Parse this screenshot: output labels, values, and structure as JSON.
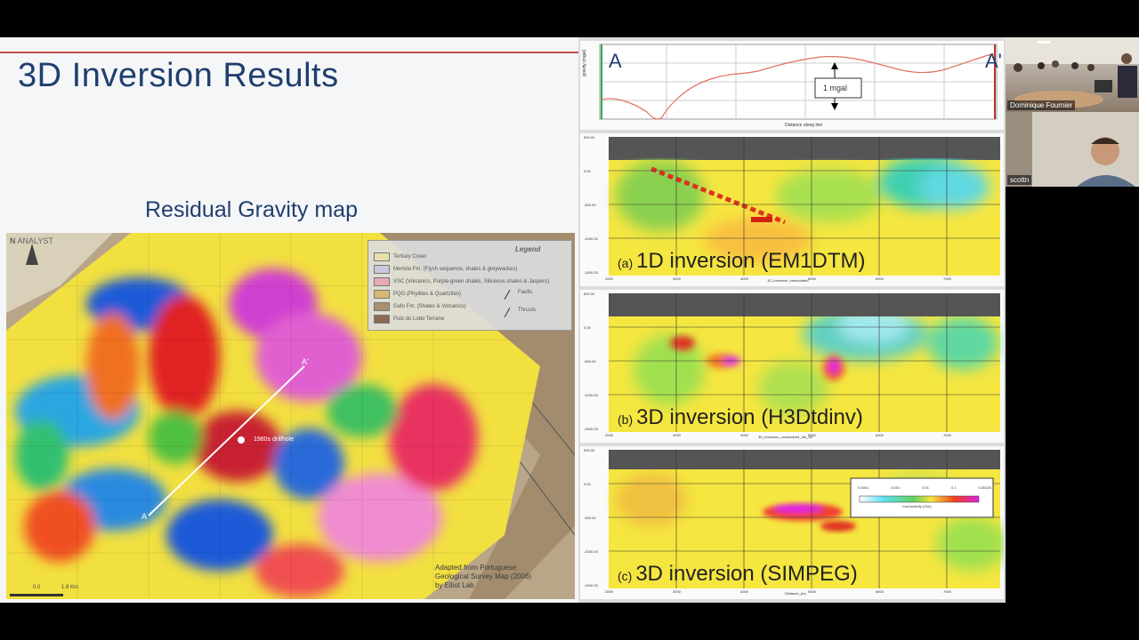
{
  "slide": {
    "title": "3D Inversion Results",
    "map_title": "Residual Gravity map",
    "map": {
      "company_logo": "ANALYST",
      "north_label": "N",
      "profile_start": "A",
      "profile_end": "A'",
      "drillhole_label": "1980s drillhole",
      "scale_labels": [
        "0.0",
        "1.8 Km"
      ],
      "credit_lines": [
        "Adapted from Portuguese",
        "Geological Survey Map (2006)",
        "by Elliot Lab"
      ]
    },
    "legend": {
      "title": "Legend",
      "items": [
        {
          "label": "Tertiary Cover",
          "color": "#e8e0a8"
        },
        {
          "label": "Mertola Fm. (Flysh sequence, shales & greywackes)",
          "color": "#c9c8e0"
        },
        {
          "label": "VSC (Volcanics, Purple-green shales, Siliceous shales & Jaspers)",
          "color": "#e8a8b8"
        },
        {
          "label": "PQG (Phyllites & Quartzites)",
          "color": "#d8b870"
        },
        {
          "label": "Gafo Fm. (Shales & Volcanics)",
          "color": "#a89070"
        },
        {
          "label": "Pulo do Lobo Terrane",
          "color": "#8a6a50"
        }
      ],
      "symbols": [
        "Faults",
        "Thrusts"
      ]
    }
  },
  "profile": {
    "start_label": "A",
    "end_label": "A'",
    "scale_label": "1 mgal",
    "x_axis_label": "Distance along line",
    "y_axis_label": "gravity (mgal)"
  },
  "sections": [
    {
      "prefix": "(a)",
      "label": "1D inversion (EM1DTM)",
      "x_label": "1D_inversion_interpolated"
    },
    {
      "prefix": "(b)",
      "label": "3D inversion (H3Dtdinv)",
      "x_label": "3D_inversion_constrained_3to_3D"
    },
    {
      "prefix": "(c)",
      "label": "3D inversion (SIMPEG)",
      "x_label": "Distance_(m)"
    }
  ],
  "section_x_ticks": [
    "2000",
    "3000",
    "4000",
    "5000",
    "6000",
    "7000"
  ],
  "section_y_ticks": [
    "500.00",
    "0.00",
    "-500.00",
    "-1000.00",
    "-1500.00"
  ],
  "colorbar": {
    "ticks": [
      "0.0001",
      "0.001",
      "0.01",
      "0.1",
      "0.00100"
    ],
    "label": "Conductivity (S/m)"
  },
  "video": {
    "participants": [
      "Dominique Fournier",
      "scottn"
    ]
  },
  "colors": {
    "title": "#1f3f6e",
    "accent_rule": "#c0504d",
    "profile_line": "#e07060"
  }
}
